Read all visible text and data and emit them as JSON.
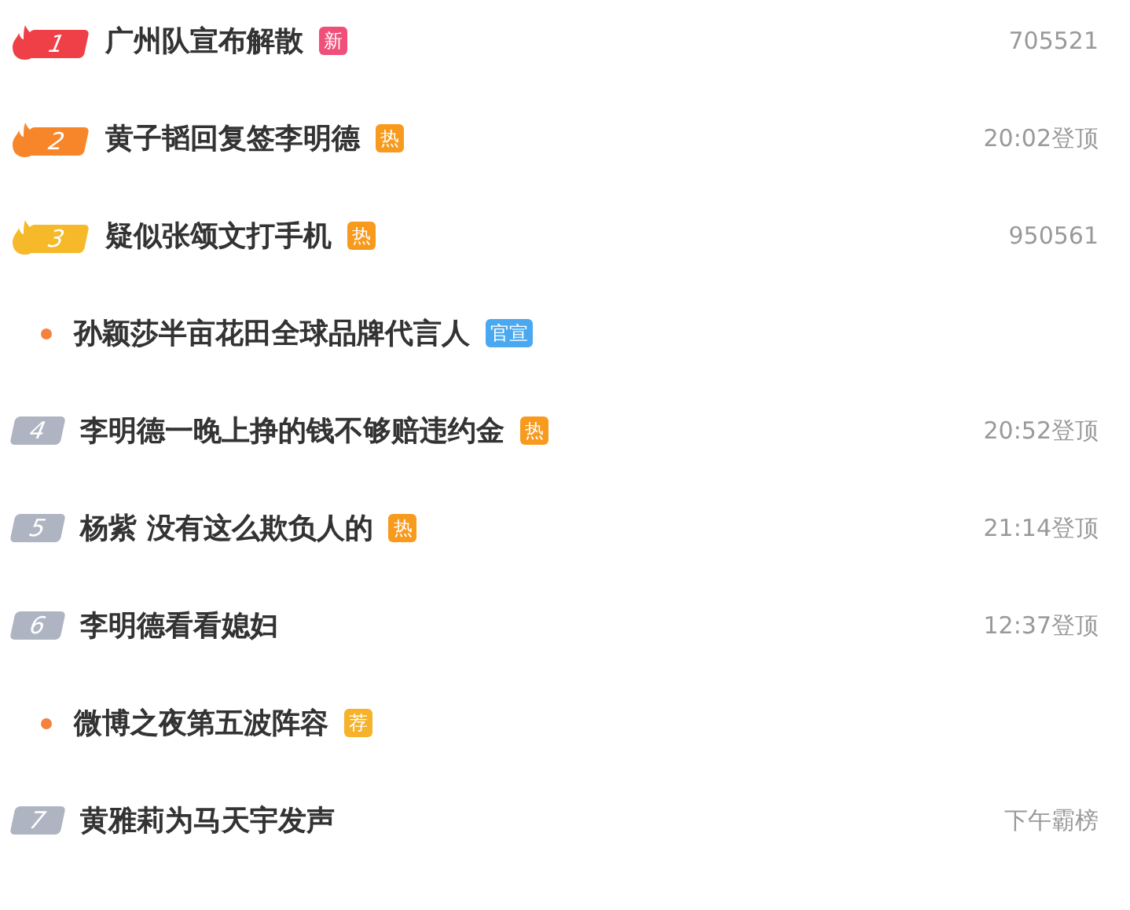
{
  "items": [
    {
      "kind": "top",
      "rank": "1",
      "color": "#ef3f47",
      "title": "广州队宣布解散",
      "tag": {
        "text": "新",
        "color": "#ef4f78"
      },
      "meta": "705521"
    },
    {
      "kind": "top",
      "rank": "2",
      "color": "#f7862b",
      "title": "黄子韬回复签李明德",
      "tag": {
        "text": "热",
        "color": "#f79a1e"
      },
      "meta": "20:02登顶"
    },
    {
      "kind": "top",
      "rank": "3",
      "color": "#f6b92a",
      "title": "疑似张颂文打手机",
      "tag": {
        "text": "热",
        "color": "#f79a1e"
      },
      "meta": "950561"
    },
    {
      "kind": "promo",
      "title": "孙颖莎半亩花田全球品牌代言人",
      "tag": {
        "text": "官宣",
        "color": "#4aa8f0"
      }
    },
    {
      "kind": "rank",
      "rank": "4",
      "title": "李明德一晚上挣的钱不够赔违约金",
      "tag": {
        "text": "热",
        "color": "#f79a1e"
      },
      "meta": "20:52登顶"
    },
    {
      "kind": "rank",
      "rank": "5",
      "title": "杨紫 没有这么欺负人的",
      "tag": {
        "text": "热",
        "color": "#f79a1e"
      },
      "meta": "21:14登顶"
    },
    {
      "kind": "rank",
      "rank": "6",
      "title": "李明德看看媳妇",
      "meta": "12:37登顶"
    },
    {
      "kind": "promo",
      "title": "微博之夜第五波阵容",
      "tag": {
        "text": "荐",
        "color": "#f5b22a"
      }
    },
    {
      "kind": "rank",
      "rank": "7",
      "title": "黄雅莉为马天宇发声",
      "meta": "下午霸榜"
    }
  ]
}
